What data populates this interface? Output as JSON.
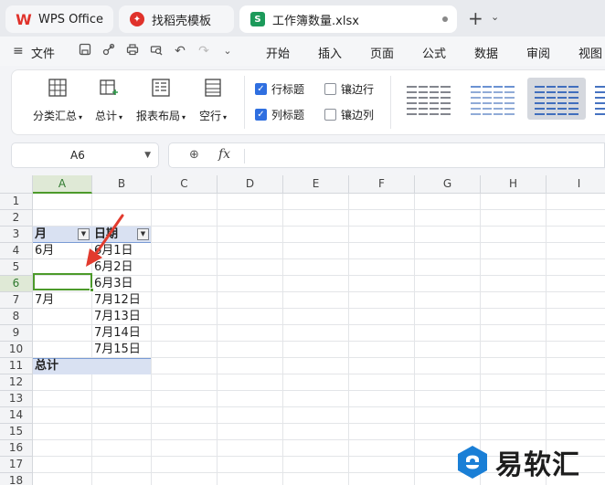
{
  "tabs": [
    {
      "label": "WPS Office"
    },
    {
      "label": "找稻壳模板"
    },
    {
      "label": "工作簿数量.xlsx"
    }
  ],
  "menu": {
    "file": "文件",
    "items": [
      "开始",
      "插入",
      "页面",
      "公式",
      "数据",
      "审阅",
      "视图"
    ]
  },
  "ribbon": {
    "buttons": [
      "分类汇总",
      "总计",
      "报表布局",
      "空行"
    ],
    "checks": [
      {
        "label": "行标题",
        "checked": true
      },
      {
        "label": "镶边行",
        "checked": false
      },
      {
        "label": "列标题",
        "checked": true
      },
      {
        "label": "镶边列",
        "checked": false
      }
    ]
  },
  "formula": {
    "cell_ref": "A6",
    "fx": "fx",
    "value": ""
  },
  "grid": {
    "columns": [
      "A",
      "B",
      "C",
      "D",
      "E",
      "F",
      "G",
      "H",
      "I"
    ],
    "rows": [
      "1",
      "2",
      "3",
      "4",
      "5",
      "6",
      "7",
      "8",
      "9",
      "10",
      "11",
      "12",
      "13",
      "14",
      "15",
      "16",
      "17",
      "18"
    ],
    "pivot_header_month": "月",
    "pivot_header_date": "日期",
    "month_jun": "6月",
    "month_jul": "7月",
    "dates": [
      "6月1日",
      "6月2日",
      "6月3日",
      "7月12日",
      "7月13日",
      "7月14日",
      "7月15日"
    ],
    "total": "总计"
  },
  "colors": {
    "accent": "#2f6fe0",
    "selection": "#4c9a2a",
    "pivot_header": "#d9e1f2",
    "arrow": "#e23b2e"
  },
  "watermark": "易软汇"
}
